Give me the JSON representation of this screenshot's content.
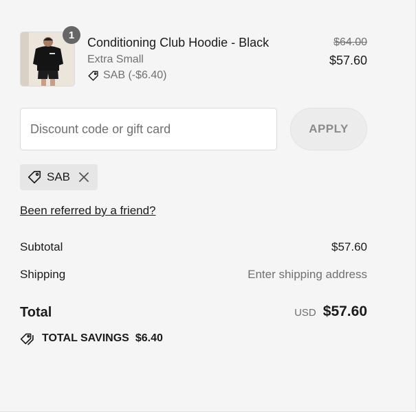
{
  "line_item": {
    "quantity": "1",
    "title": "Conditioning Club Hoodie - Black",
    "variant": "Extra Small",
    "discount": "SAB (-$6.40)",
    "price_original": "$64.00",
    "price_final": "$57.60",
    "thumbnail_icon": "product-photo"
  },
  "discount_form": {
    "placeholder": "Discount code or gift card",
    "value": "",
    "apply_label": "APPLY"
  },
  "applied_code": {
    "code": "SAB",
    "tag_icon": "tag-icon",
    "remove_icon": "close-icon"
  },
  "referral_link": "Been referred by a friend?",
  "summary": {
    "subtotal_label": "Subtotal",
    "subtotal_value": "$57.60",
    "shipping_label": "Shipping",
    "shipping_value": "Enter shipping address",
    "total_label": "Total",
    "currency": "USD",
    "total_value": "$57.60",
    "savings_label": "TOTAL SAVINGS",
    "savings_value": "$6.40"
  },
  "colors": {
    "background": "#f5f5f5",
    "text": "#1a1a1a",
    "muted": "#707070",
    "badge": "#666666"
  }
}
